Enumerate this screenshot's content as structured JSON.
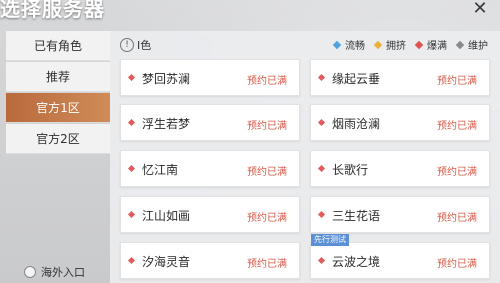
{
  "title": "选择服务器",
  "close_icon": "close-icon",
  "sidebar": {
    "tabs": [
      {
        "label": "已有角色",
        "active": false
      },
      {
        "label": "推荐",
        "active": false
      },
      {
        "label": "官方1区",
        "active": true
      },
      {
        "label": "官方2区",
        "active": false
      }
    ],
    "overseas_label": "海外入口"
  },
  "panel": {
    "section_label": "I色",
    "legend": [
      {
        "label": "流畅",
        "color": "#4ea3e0"
      },
      {
        "label": "拥挤",
        "color": "#e9b13a"
      },
      {
        "label": "爆满",
        "color": "#e0524f"
      },
      {
        "label": "维护",
        "color": "#8a8a8a"
      }
    ],
    "servers": [
      {
        "name": "梦回苏澜",
        "status": "预约已满",
        "badge": ""
      },
      {
        "name": "缘起云垂",
        "status": "预约已满",
        "badge": ""
      },
      {
        "name": "浮生若梦",
        "status": "预约已满",
        "badge": ""
      },
      {
        "name": "烟雨沧澜",
        "status": "预约已满",
        "badge": ""
      },
      {
        "name": "忆江南",
        "status": "预约已满",
        "badge": ""
      },
      {
        "name": "长歌行",
        "status": "预约已满",
        "badge": ""
      },
      {
        "name": "江山如画",
        "status": "预约已满",
        "badge": ""
      },
      {
        "name": "三生花语",
        "status": "预约已满",
        "badge": ""
      },
      {
        "name": "汐海灵音",
        "status": "预约已满",
        "badge": ""
      },
      {
        "name": "云波之境",
        "status": "预约已满",
        "badge": "先行测试"
      }
    ],
    "status_color": "#e0524f"
  }
}
